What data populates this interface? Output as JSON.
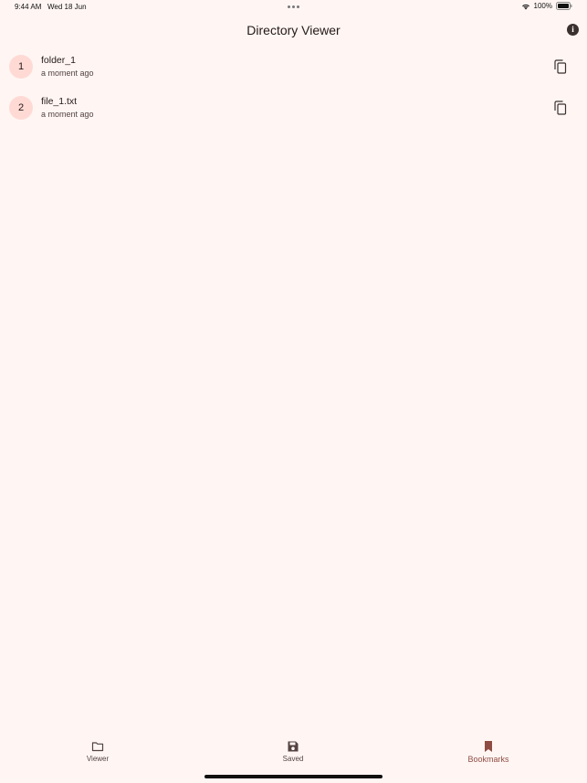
{
  "status_bar": {
    "time": "9:44 AM",
    "date": "Wed 18 Jun",
    "battery": "100%"
  },
  "app_bar": {
    "title": "Directory Viewer",
    "info_icon": "info-icon"
  },
  "items": [
    {
      "index": "1",
      "name": "folder_1",
      "subtitle": "a moment ago",
      "action_icon": "copy-icon"
    },
    {
      "index": "2",
      "name": "file_1.txt",
      "subtitle": "a moment ago",
      "action_icon": "copy-icon"
    }
  ],
  "bottom_nav": {
    "items": [
      {
        "label": "Viewer",
        "icon": "folder-icon",
        "active": false
      },
      {
        "label": "Saved",
        "icon": "save-icon",
        "active": false
      },
      {
        "label": "Bookmarks",
        "icon": "bookmark-icon",
        "active": true
      }
    ]
  },
  "colors": {
    "background": "#fff6f4",
    "avatar_bg": "#ffdad4",
    "accent": "#8f4c42"
  }
}
